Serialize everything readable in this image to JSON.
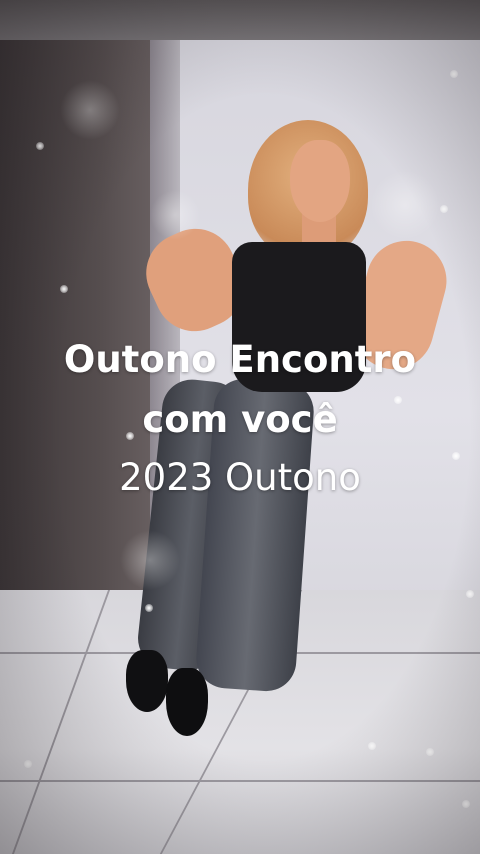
{
  "overlay_text": {
    "line1": "Outono Encontro",
    "line2": "com você",
    "line3": "2023 Outono"
  },
  "colors": {
    "text": "#ffffff",
    "wall": "#dcdbe2",
    "top": "#1b1a1d",
    "jeans": "#4e5159"
  }
}
